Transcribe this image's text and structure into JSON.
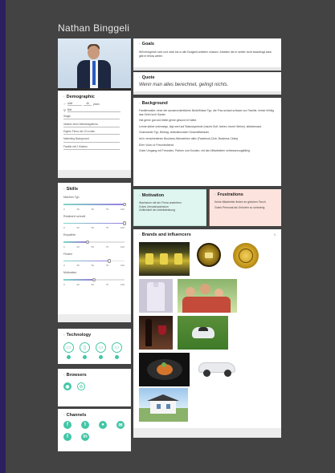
{
  "persona_name": "Nathan Binggeli",
  "demographic": {
    "title": "Demographic",
    "age_label": "Alter",
    "age_value": "45",
    "age_unit": "years",
    "location": "Biel",
    "lines": [
      "Single",
      "Inhaber einer Webdesignfirma",
      "Eigene Firma mit 10 Leuten",
      "Marketing Background",
      "Familie mit 2 Kindern"
    ]
  },
  "skills": {
    "title": "Skills",
    "tick_labels": [
      "0",
      "25",
      "50",
      "75",
      "100"
    ],
    "items": [
      {
        "label": "Machen Typ",
        "value": 100
      },
      {
        "label": "Realisiert schnell",
        "value": 100
      },
      {
        "label": "Empathie",
        "value": 40
      },
      {
        "label": "Finden",
        "value": 75
      },
      {
        "label": "Motivation",
        "value": 50
      }
    ]
  },
  "technology": {
    "title": "Technology",
    "icons": [
      "desktop-icon",
      "tablet-icon",
      "laptop-icon",
      "monitor-icon"
    ]
  },
  "browsers": {
    "title": "Browsers",
    "icons": [
      "chrome-icon",
      "safari-icon"
    ]
  },
  "channels": {
    "title": "Channels",
    "icons": [
      "facebook-icon",
      "tumblr-icon",
      "user-icon",
      "mail-icon",
      "fb-icon",
      "linkedin-icon"
    ]
  },
  "goals": {
    "title": "Goals",
    "text": "Will erfolgreich sein und nicht bis in alle Ewigkeit arbeiten müssen. Arbeiten die er selber nicht beauftragt kann gibt er fellow weiter."
  },
  "quote": {
    "title": "Quote",
    "text": "Wenn man alles berechnet, gelingt nichts."
  },
  "background": {
    "title": "Background",
    "paragraphs": [
      "Familienvater, einer der ausserordentlichen Bedürfnisse Typ, die Frau schaut schwarz zur Familie, immer fröhlig das Geld noch Sauter.",
      "Hat gerne gut und bleibt gerne gesund im Wald.",
      "Lernte aktive unterwegs, legt wert auf Statussymbole (macht Golf, fahren, teurer Weine), stilsbewusst.",
      "Charmanter Typ, Beitrag, amiknikmosten Geschäftsfrauen.",
      "Ist in verschiedenen Business-Netzwerken aktiv (Facebook-Club, Business Clubs)",
      "Eher Volvo or Freundedienst.",
      "Guter Umgang mit Freunden, Partner und Kunden, mit den Mitarbeitern verbesserungsfähig."
    ]
  },
  "motivation": {
    "title": "Motivation",
    "lines": [
      "Wachstum mit der Firma anstreben",
      "Gutes Umsatzwachstum",
      "Zeitlichkeit der Arbeitsleistung"
    ]
  },
  "frustrations": {
    "title": "Frustrations",
    "lines": [
      "Keine Mitarbeiter finden im gleichen Tench",
      "Gutes Personal als Gründen zu schwierig"
    ]
  },
  "brands": {
    "title": "Brands and influencers",
    "count": "9"
  },
  "colors": {
    "accent": "#43c6a6",
    "motivation_bg": "#dff5ef",
    "frustration_bg": "#fde3dd",
    "frustration_border": "#e0402b"
  }
}
